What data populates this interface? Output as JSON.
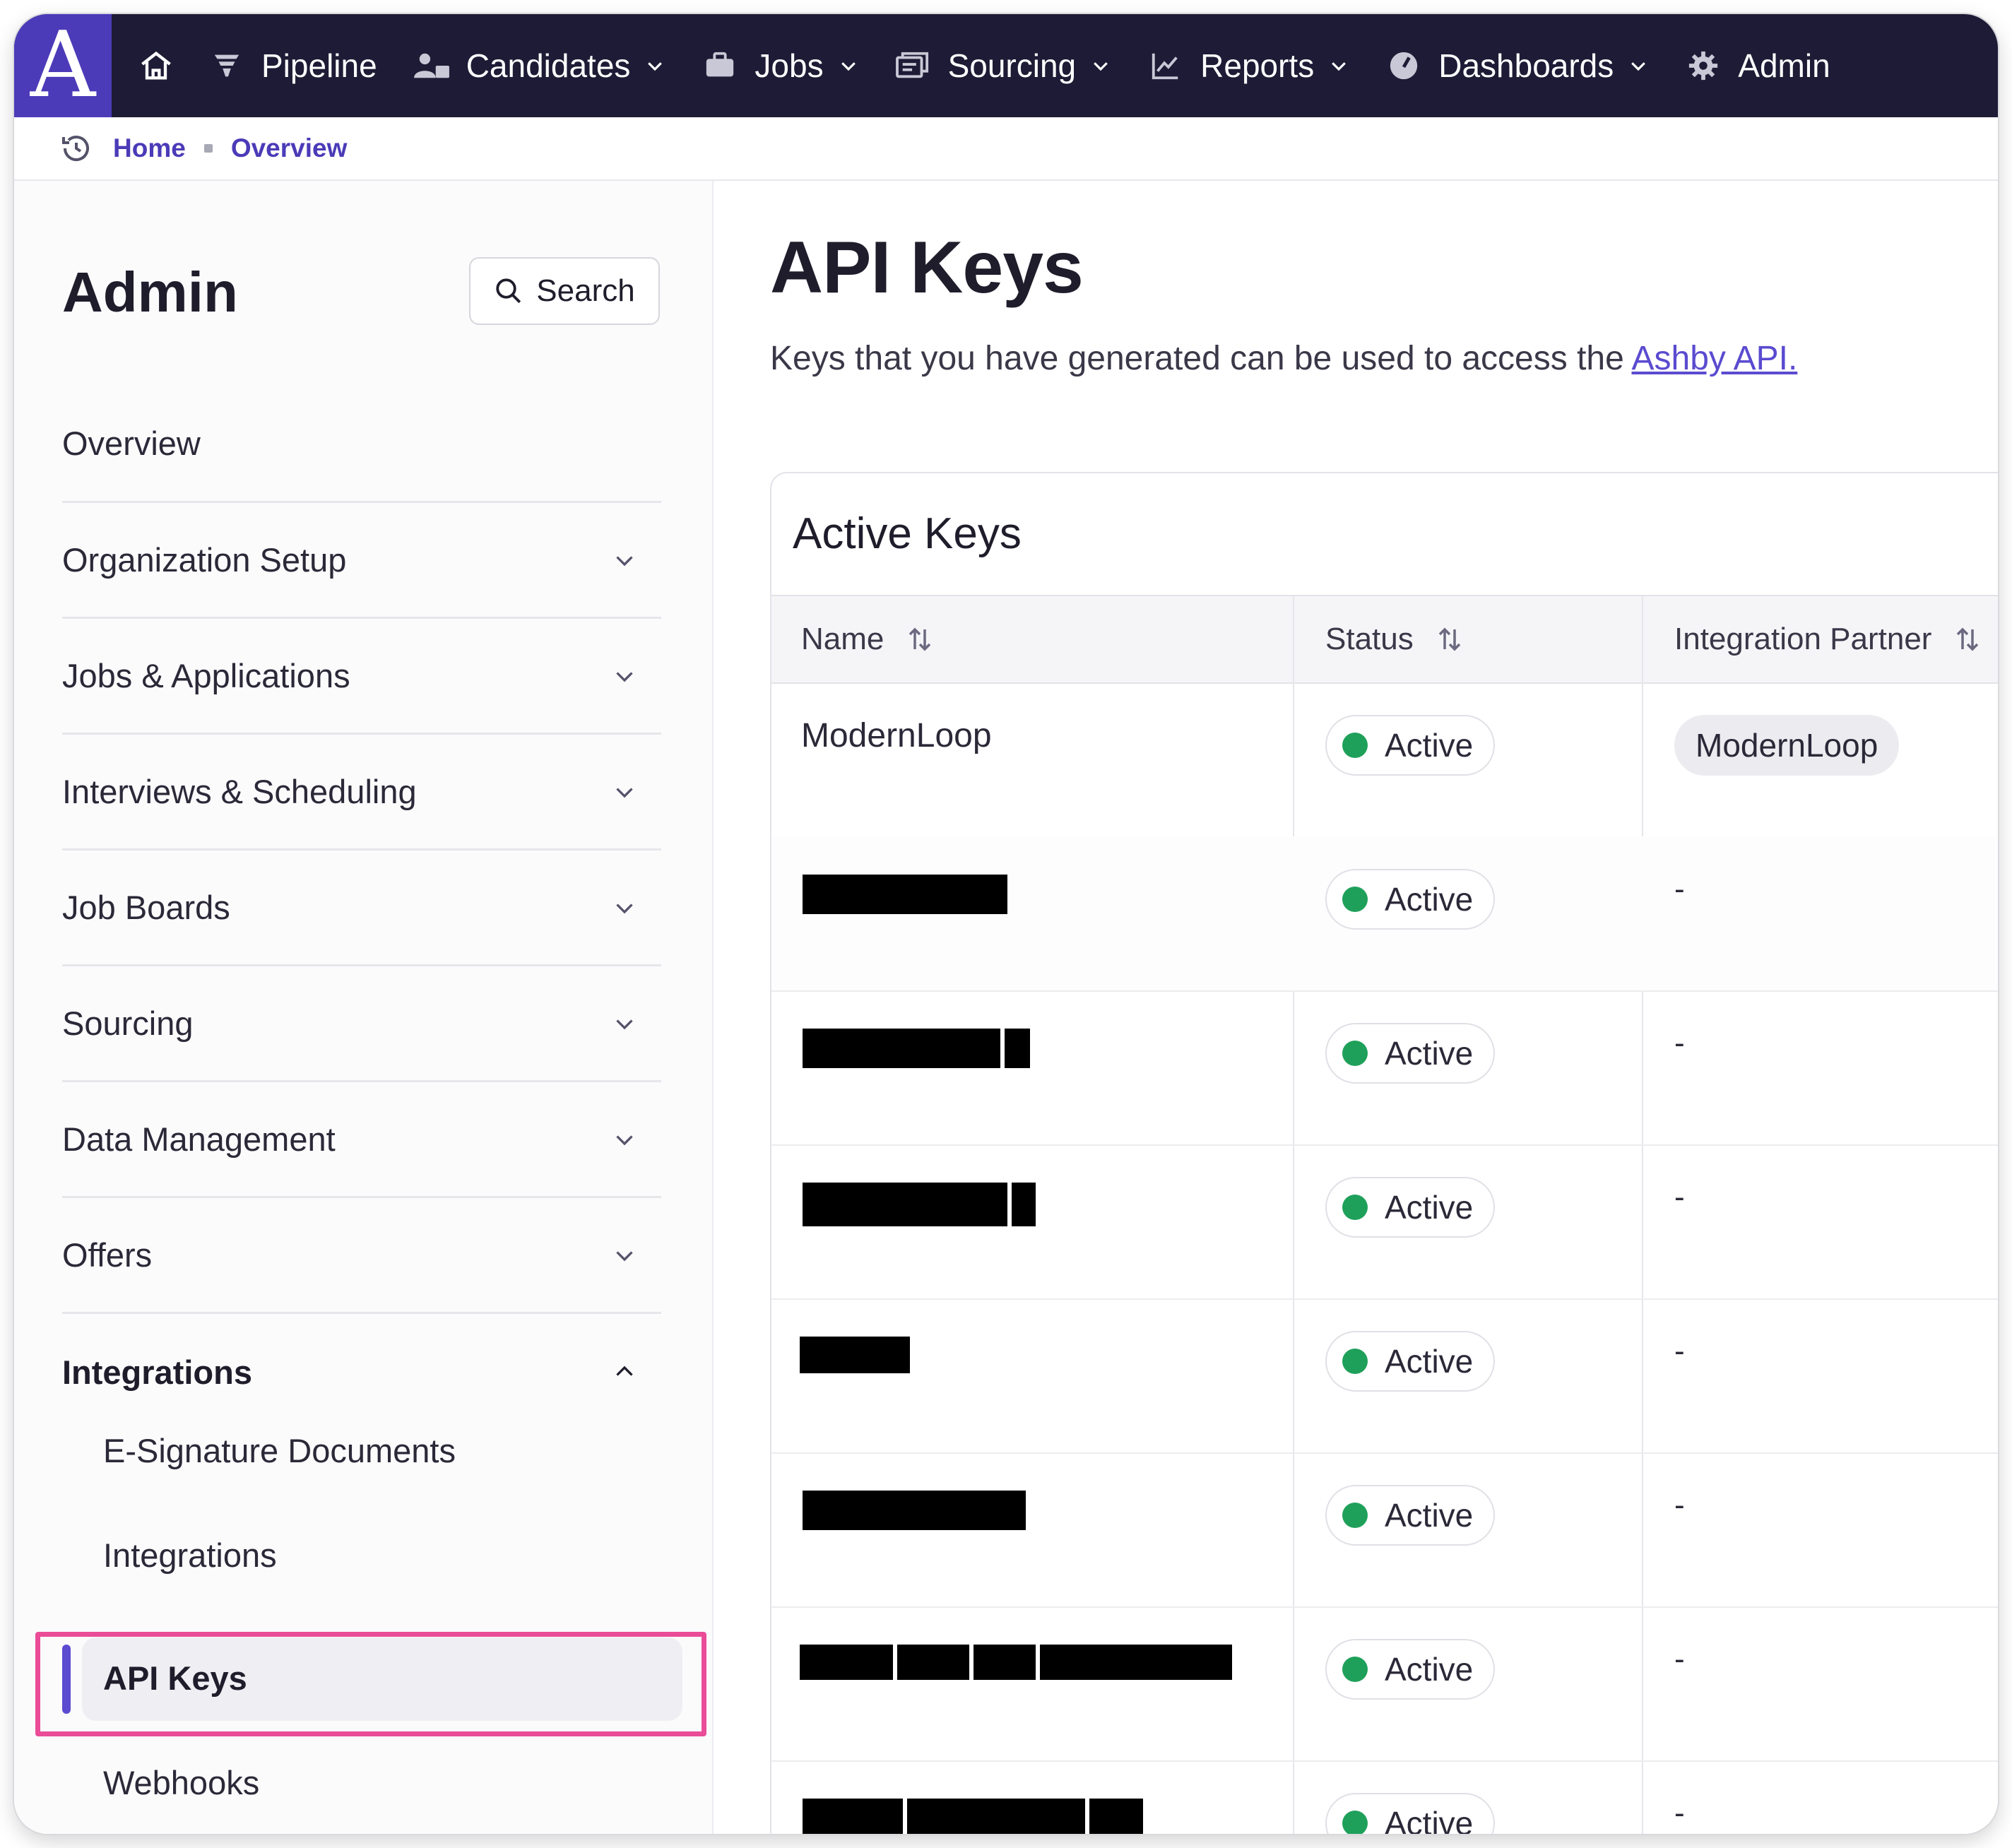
{
  "topnav": {
    "logo": "A",
    "items": [
      {
        "label": "Pipeline",
        "icon": "filter-icon",
        "dropdown": false
      },
      {
        "label": "Candidates",
        "icon": "users-icon",
        "dropdown": true
      },
      {
        "label": "Jobs",
        "icon": "briefcase-icon",
        "dropdown": true
      },
      {
        "label": "Sourcing",
        "icon": "sourcing-icon",
        "dropdown": true
      },
      {
        "label": "Reports",
        "icon": "chart-icon",
        "dropdown": true
      },
      {
        "label": "Dashboards",
        "icon": "gauge-icon",
        "dropdown": true
      },
      {
        "label": "Admin",
        "icon": "gear-icon",
        "dropdown": false
      }
    ]
  },
  "breadcrumb": {
    "home": "Home",
    "current": "Overview"
  },
  "sidebar": {
    "title": "Admin",
    "search_label": "Search",
    "items": [
      {
        "label": "Overview"
      },
      {
        "label": "Organization Setup"
      },
      {
        "label": "Jobs & Applications"
      },
      {
        "label": "Interviews & Scheduling"
      },
      {
        "label": "Job Boards"
      },
      {
        "label": "Sourcing"
      },
      {
        "label": "Data Management"
      },
      {
        "label": "Offers"
      },
      {
        "label": "Integrations"
      }
    ],
    "subitems": [
      {
        "label": "E-Signature Documents"
      },
      {
        "label": "Integrations"
      },
      {
        "label": "API Keys"
      },
      {
        "label": "Webhooks"
      }
    ]
  },
  "main": {
    "title": "API Keys",
    "description": "Keys that you have generated can be used to access the ",
    "description_link": "Ashby API.",
    "card_title": "Active Keys",
    "columns": {
      "name": "Name",
      "status": "Status",
      "partner": "Integration Partner"
    },
    "rows": [
      {
        "name": "ModernLoop",
        "status": "Active",
        "partner": "ModernLoop"
      },
      {
        "name": "",
        "status": "Active",
        "partner": "-"
      },
      {
        "name": "",
        "status": "Active",
        "partner": "-"
      },
      {
        "name": "",
        "status": "Active",
        "partner": "-"
      },
      {
        "name": "",
        "status": "Active",
        "partner": "-"
      },
      {
        "name": "",
        "status": "Active",
        "partner": "-"
      },
      {
        "name": "",
        "status": "Active",
        "partner": "-"
      },
      {
        "name": "",
        "status": "Active",
        "partner": "-"
      }
    ]
  },
  "colors": {
    "nav_bg": "#1d1b35",
    "brand": "#4b3bb8",
    "accent": "#5a4bd0",
    "active_dot": "#1fa05a",
    "highlight": "#ea4c98"
  }
}
